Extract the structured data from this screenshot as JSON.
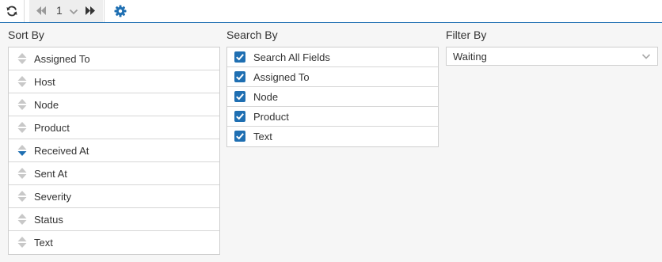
{
  "toolbar": {
    "page_number": "1",
    "accent": "#1f6fb2"
  },
  "columns": {
    "sort_title": "Sort By",
    "search_title": "Search By",
    "filter_title": "Filter By"
  },
  "sort_items": [
    {
      "label": "Assigned To",
      "state": "none"
    },
    {
      "label": "Host",
      "state": "none"
    },
    {
      "label": "Node",
      "state": "none"
    },
    {
      "label": "Product",
      "state": "none"
    },
    {
      "label": "Received At",
      "state": "descending"
    },
    {
      "label": "Sent At",
      "state": "none"
    },
    {
      "label": "Severity",
      "state": "none"
    },
    {
      "label": "Status",
      "state": "none"
    },
    {
      "label": "Text",
      "state": "none"
    }
  ],
  "search_items": [
    {
      "label": "Search All Fields",
      "checked": true
    },
    {
      "label": "Assigned To",
      "checked": true
    },
    {
      "label": "Node",
      "checked": true
    },
    {
      "label": "Product",
      "checked": true
    },
    {
      "label": "Text",
      "checked": true
    }
  ],
  "filter": {
    "selected": "Waiting"
  }
}
